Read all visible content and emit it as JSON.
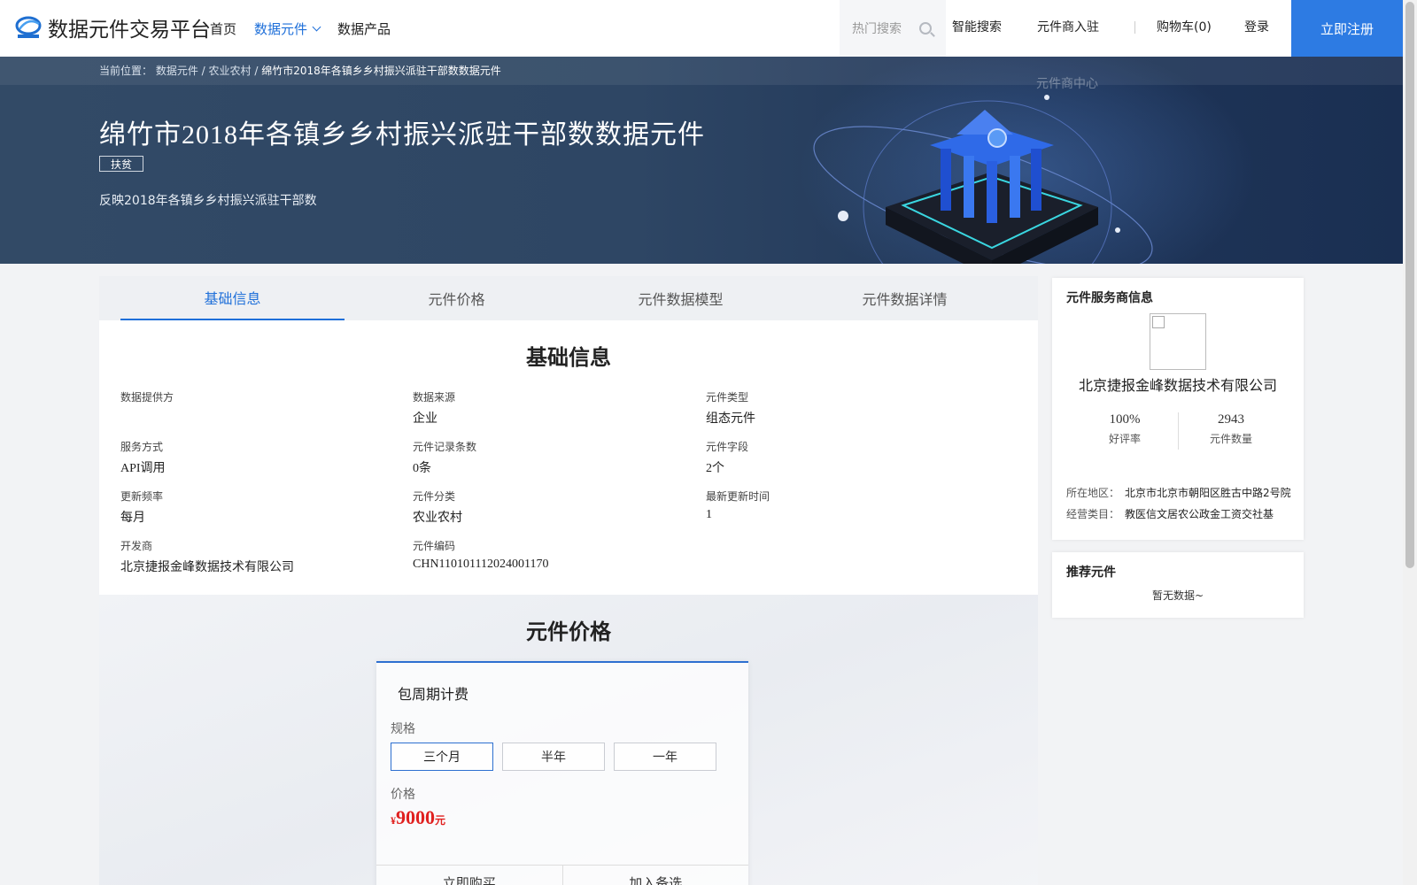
{
  "header": {
    "logo_text": "数据元件交易平台",
    "nav": [
      {
        "label": "首页"
      },
      {
        "label": "数据元件"
      },
      {
        "label": "数据产品"
      }
    ],
    "search_placeholder": "热门搜索",
    "smart_search": "智能搜索",
    "merchant_join": "元件商入驻",
    "cart": "购物车(0)",
    "login": "登录",
    "register": "立即注册",
    "merchant_center": "元件商中心"
  },
  "banner": {
    "breadcrumb_prefix": "当前位置：",
    "breadcrumb": [
      "数据元件",
      "农业农村",
      "绵竹市2018年各镇乡乡村振兴派驻干部数数据元件"
    ],
    "title": "绵竹市2018年各镇乡乡村振兴派驻干部数数据元件",
    "tag": "扶贫",
    "description": "反映2018年各镇乡乡村振兴派驻干部数"
  },
  "tabs": [
    {
      "label": "基础信息"
    },
    {
      "label": "元件价格"
    },
    {
      "label": "元件数据模型"
    },
    {
      "label": "元件数据详情"
    }
  ],
  "basic_info": {
    "title": "基础信息",
    "fields": [
      {
        "label": "数据提供方",
        "value": ""
      },
      {
        "label": "数据来源",
        "value": "企业"
      },
      {
        "label": "元件类型",
        "value": "组态元件"
      },
      {
        "label": "服务方式",
        "value": "API调用"
      },
      {
        "label": "元件记录条数",
        "value": "0条"
      },
      {
        "label": "元件字段",
        "value": "2个"
      },
      {
        "label": "更新频率",
        "value": "每月"
      },
      {
        "label": "元件分类",
        "value": "农业农村"
      },
      {
        "label": "最新更新时间",
        "value": "1"
      },
      {
        "label": "开发商",
        "value": "北京捷报金峰数据技术有限公司"
      },
      {
        "label": "元件编码",
        "value": "CHN110101112024001170"
      }
    ]
  },
  "pricing": {
    "title": "元件价格",
    "card_title": "包周期计费",
    "spec_label": "规格",
    "specs": [
      "三个月",
      "半年",
      "一年"
    ],
    "selected_spec": "三个月",
    "price_label": "价格",
    "currency": "¥",
    "price": "9000",
    "unit": "元",
    "buy_now": "立即购买",
    "add_to_list": "加入备选"
  },
  "provider": {
    "title": "元件服务商信息",
    "name": "北京捷报金峰数据技术有限公司",
    "rating": "100%",
    "rating_label": "好评率",
    "count": "2943",
    "count_label": "元件数量",
    "region_label": "所在地区：",
    "region": "北京市北京市朝阳区胜古中路2号院",
    "category_label": "经营类目：",
    "category": "教医信文居农公政金工资交社基"
  },
  "recommend": {
    "title": "推荐元件",
    "empty": "暂无数据~"
  },
  "colors": {
    "accent": "#1e6fd9",
    "register_bg": "#2d7be3",
    "price_red": "#e0201f"
  }
}
